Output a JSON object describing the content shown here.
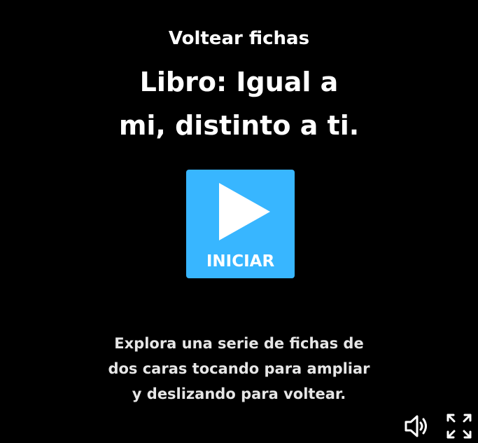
{
  "activity_type": "Voltear fichas",
  "title_lines": [
    "Libro: Igual a",
    "mi, distinto a ti."
  ],
  "start_button": {
    "label": "INICIAR",
    "icon": "play-icon",
    "color": "#38b6ff"
  },
  "description_lines": [
    "Explora una serie de fichas de",
    "dos caras tocando para ampliar",
    "y deslizando para voltear."
  ],
  "controls": {
    "sound_icon": "speaker-icon",
    "fullscreen_icon": "fullscreen-icon"
  },
  "colors": {
    "background": "#000000",
    "text": "#ffffff",
    "accent": "#38b6ff"
  }
}
